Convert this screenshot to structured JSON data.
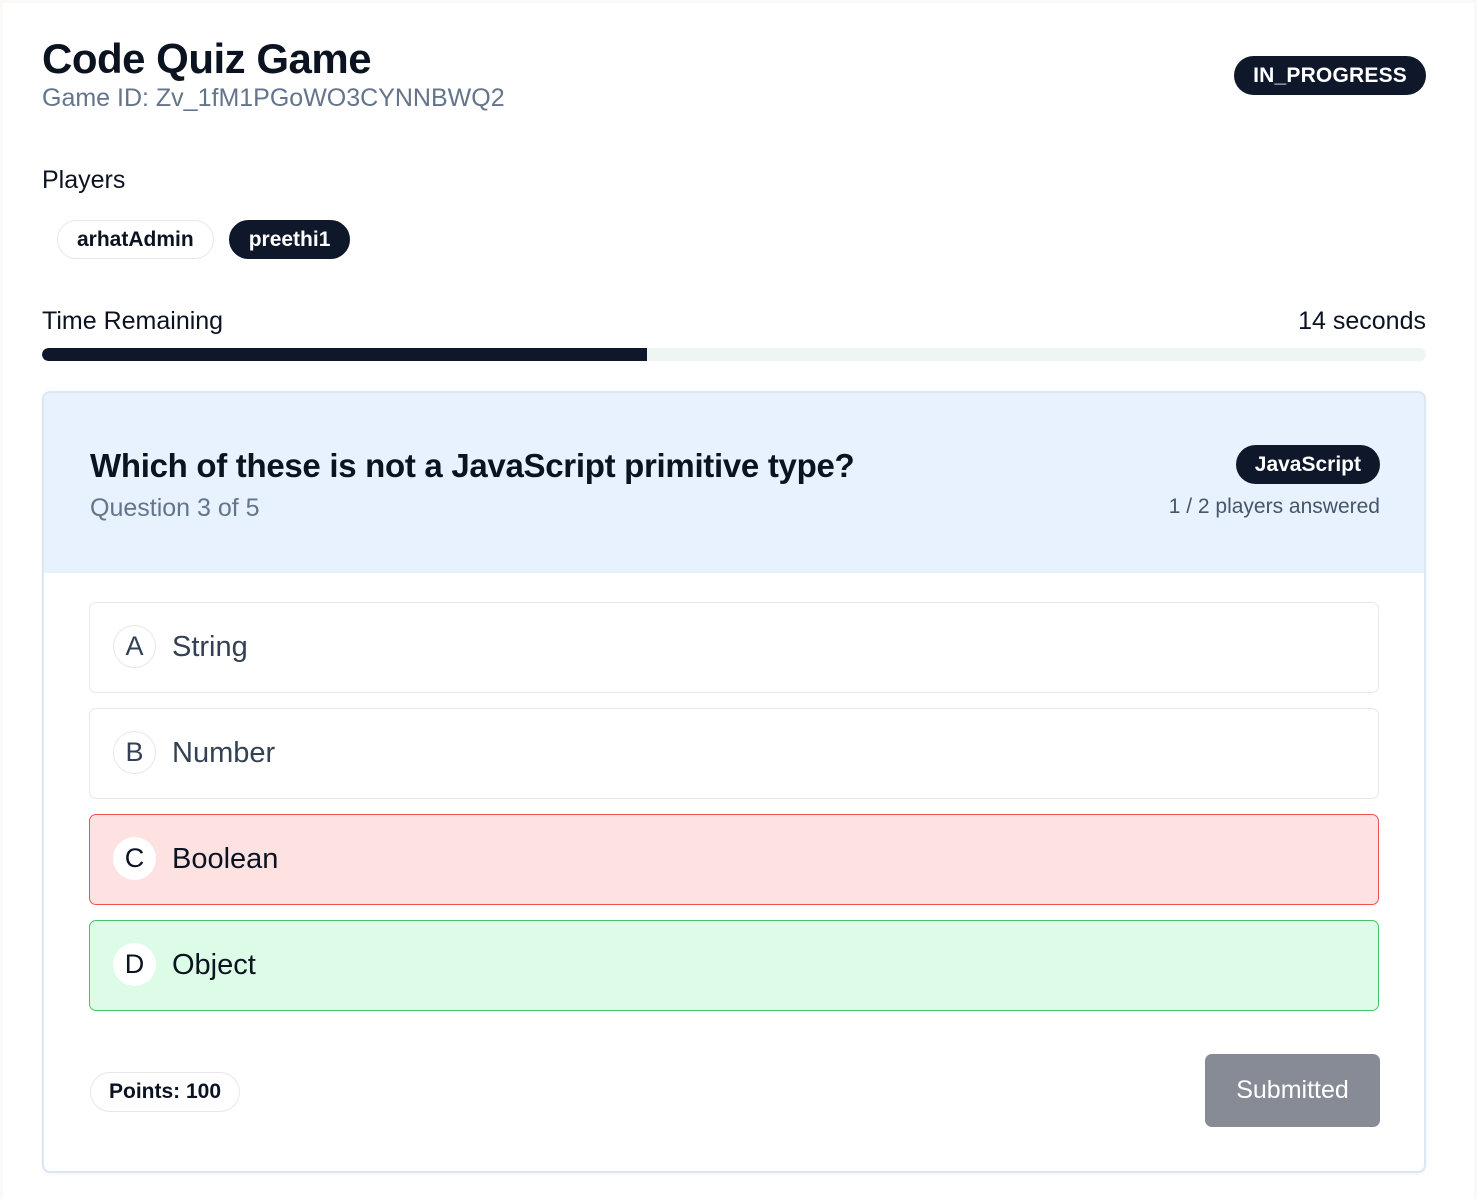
{
  "header": {
    "title": "Code Quiz Game",
    "game_id": "Game ID: Zv_1fM1PGoWO3CYNNBWQ2",
    "status": "IN_PROGRESS"
  },
  "players": {
    "label": "Players",
    "list": [
      {
        "name": "arhatAdmin",
        "active": false
      },
      {
        "name": "preethi1",
        "active": true
      }
    ]
  },
  "timer": {
    "label": "Time Remaining",
    "value": "14 seconds",
    "progress_fraction": 0.437
  },
  "question": {
    "text": "Which of these is not a JavaScript primitive type?",
    "progress": "Question 3 of 5",
    "category": "JavaScript",
    "answered": "1 / 2 players answered",
    "options": [
      {
        "letter": "A",
        "text": "String",
        "state": "neutral"
      },
      {
        "letter": "B",
        "text": "Number",
        "state": "neutral"
      },
      {
        "letter": "C",
        "text": "Boolean",
        "state": "incorrect"
      },
      {
        "letter": "D",
        "text": "Object",
        "state": "correct"
      }
    ],
    "points": "Points: 100",
    "submit_label": "Submitted"
  },
  "colors": {
    "primary": "#0f172a",
    "incorrect_bg": "#fee2e2",
    "incorrect_border": "#f05252",
    "correct_bg": "#dcfce7",
    "correct_border": "#43c46b",
    "card_head_bg": "#e8f2fe",
    "submitted_button": "#868b95"
  }
}
